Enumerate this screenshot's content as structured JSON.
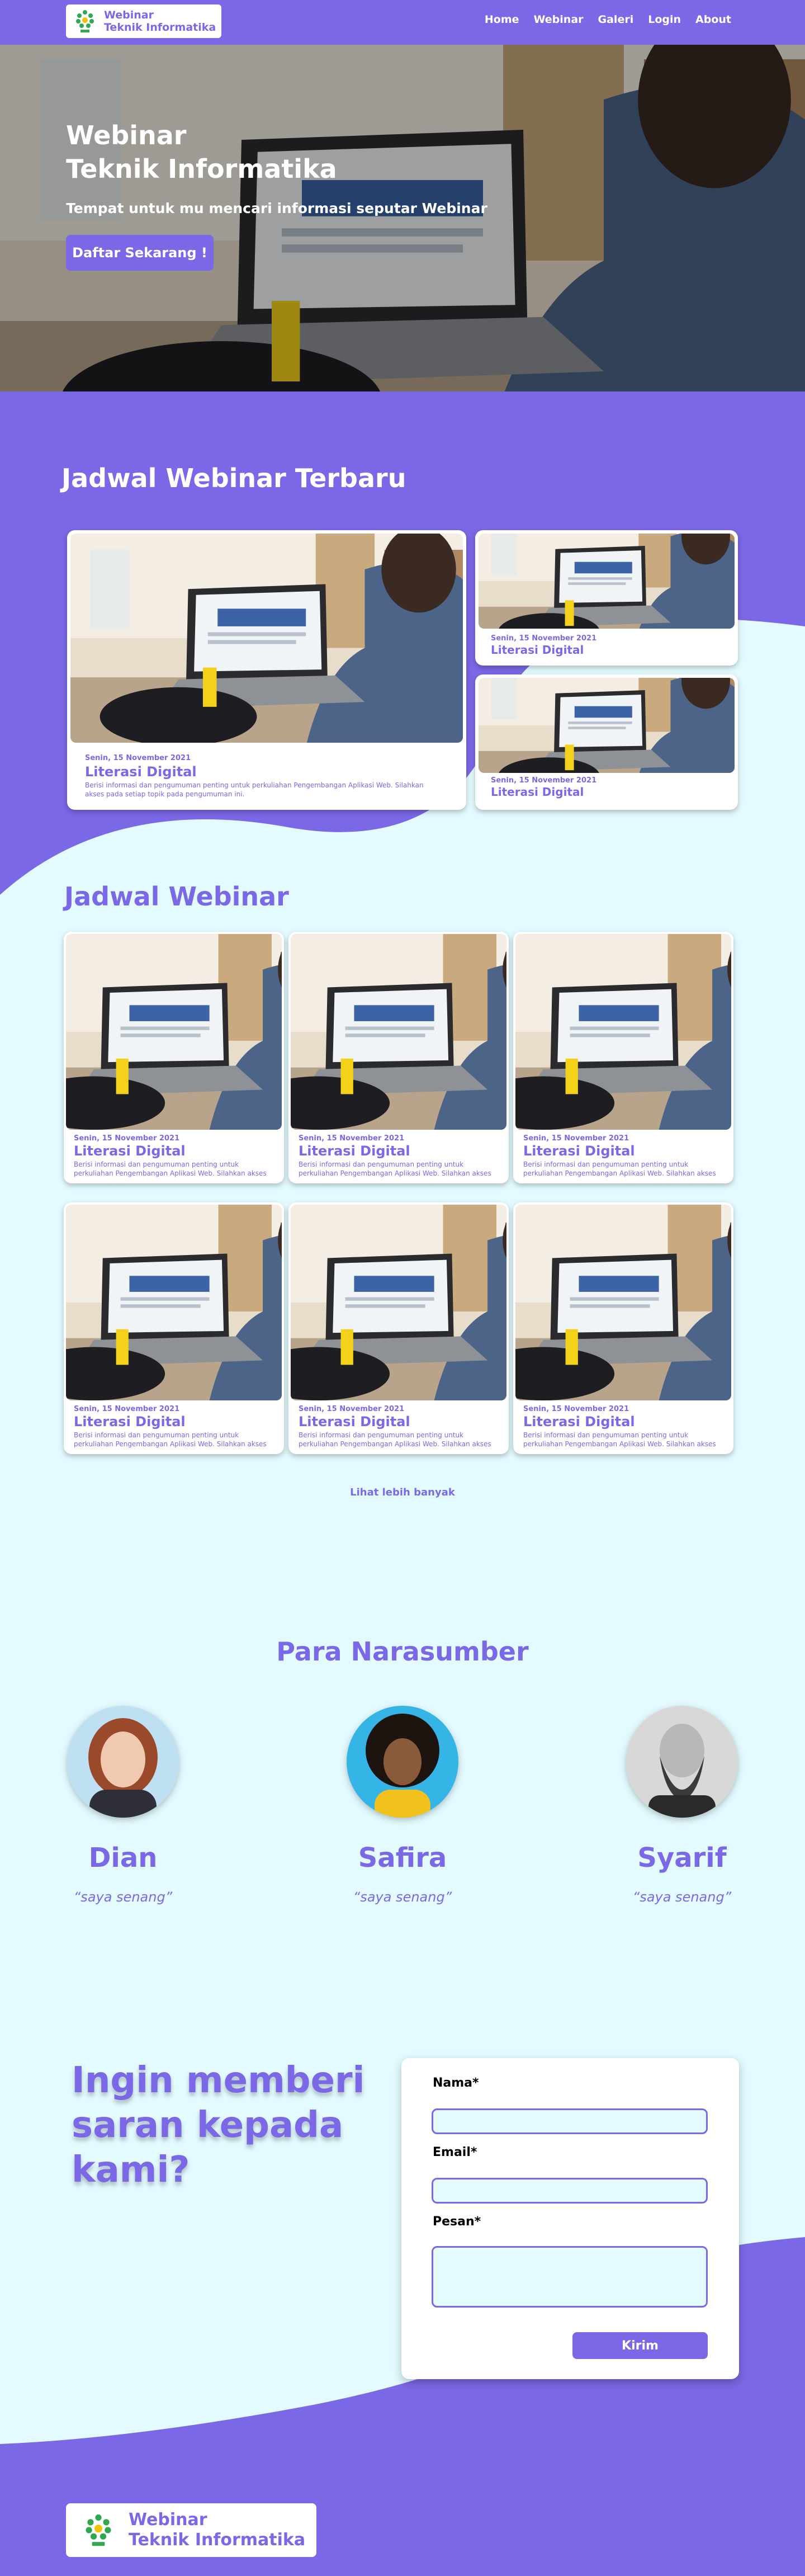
{
  "brand": {
    "line1": "Webinar",
    "line2": "Teknik Informatika",
    "logo_icon": "uin-logo-icon"
  },
  "nav": {
    "items": [
      "Home",
      "Webinar",
      "Galeri",
      "Login",
      "About"
    ]
  },
  "hero": {
    "title_line1": "Webinar",
    "title_line2": "Teknik Informatika",
    "subtitle": "Tempat untuk mu mencari informasi seputar Webinar",
    "cta": "Daftar Sekarang !"
  },
  "latest": {
    "title": "Jadwal Webinar Terbaru",
    "main": {
      "date": "Senin, 15 November 2021",
      "title": "Literasi Digital",
      "desc": "Berisi informasi dan pengumuman penting untuk perkuliahan Pengembangan Aplikasi Web. Silahkan akses pada setiap topik pada pengumuman ini."
    },
    "side": [
      {
        "date": "Senin, 15 November 2021",
        "title": "Literasi Digital"
      },
      {
        "date": "Senin, 15 November 2021",
        "title": "Literasi Digital"
      }
    ]
  },
  "schedule": {
    "title": "Jadwal Webinar",
    "cards": [
      {
        "date": "Senin, 15 November 2021",
        "title": "Literasi Digital",
        "desc": "Berisi informasi dan pengumuman penting untuk perkuliahan Pengembangan Aplikasi Web. Silahkan akses"
      },
      {
        "date": "Senin, 15 November 2021",
        "title": "Literasi Digital",
        "desc": "Berisi informasi dan pengumuman penting untuk perkuliahan Pengembangan Aplikasi Web. Silahkan akses"
      },
      {
        "date": "Senin, 15 November 2021",
        "title": "Literasi Digital",
        "desc": "Berisi informasi dan pengumuman penting untuk perkuliahan Pengembangan Aplikasi Web. Silahkan akses"
      },
      {
        "date": "Senin, 15 November 2021",
        "title": "Literasi Digital",
        "desc": "Berisi informasi dan pengumuman penting untuk perkuliahan Pengembangan Aplikasi Web. Silahkan akses"
      },
      {
        "date": "Senin, 15 November 2021",
        "title": "Literasi Digital",
        "desc": "Berisi informasi dan pengumuman penting untuk perkuliahan Pengembangan Aplikasi Web. Silahkan akses"
      },
      {
        "date": "Senin, 15 November 2021",
        "title": "Literasi Digital",
        "desc": "Berisi informasi dan pengumuman penting untuk perkuliahan Pengembangan Aplikasi Web. Silahkan akses"
      }
    ],
    "more": "Lihat lebih banyak"
  },
  "speakers": {
    "title": "Para Narasumber",
    "items": [
      {
        "name": "Dian",
        "quote": "“saya senang”"
      },
      {
        "name": "Safira",
        "quote": "“saya senang”"
      },
      {
        "name": "Syarif",
        "quote": "“saya senang”"
      }
    ]
  },
  "contact": {
    "headline_line1": "Ingin memberi",
    "headline_line2": "saran kepada",
    "headline_line3": "kami?",
    "name_label": "Nama*",
    "email_label": "Email*",
    "message_label": "Pesan*",
    "submit": "Kirim"
  },
  "colors": {
    "primary": "#7b68e6",
    "background": "#e3fbff",
    "white": "#ffffff"
  }
}
